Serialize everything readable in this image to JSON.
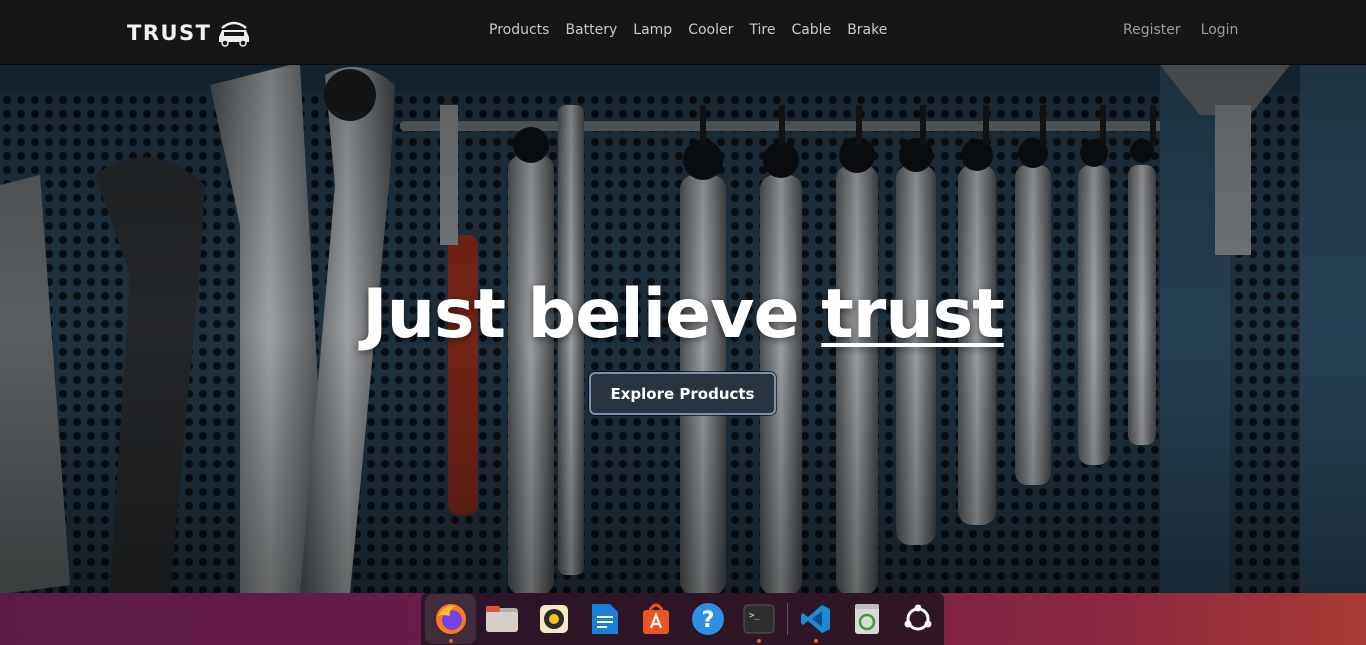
{
  "brand": {
    "name": "TRUST"
  },
  "nav": {
    "links": [
      "Products",
      "Battery",
      "Lamp",
      "Cooler",
      "Tire",
      "Cable",
      "Brake"
    ],
    "register": "Register",
    "login": "Login"
  },
  "hero": {
    "title_main": "Just believe ",
    "title_accent": "trust",
    "cta": "Explore Products"
  },
  "dock": {
    "apps": [
      {
        "name": "firefox",
        "running": true
      },
      {
        "name": "files",
        "running": false
      },
      {
        "name": "rhythmbox",
        "running": false
      },
      {
        "name": "libreoffice-writer",
        "running": false
      },
      {
        "name": "app-center",
        "running": false
      },
      {
        "name": "help",
        "running": false
      },
      {
        "name": "terminal",
        "running": true
      },
      {
        "name": "vscode",
        "running": true
      },
      {
        "name": "trash",
        "running": false
      },
      {
        "name": "show-apps",
        "running": false
      }
    ]
  },
  "colors": {
    "navbar": "#161616",
    "hero_bg": "#1a2a36",
    "button_border": "#7d90b0",
    "taskbar_start": "#5b1a45",
    "taskbar_end": "#a93a32"
  }
}
